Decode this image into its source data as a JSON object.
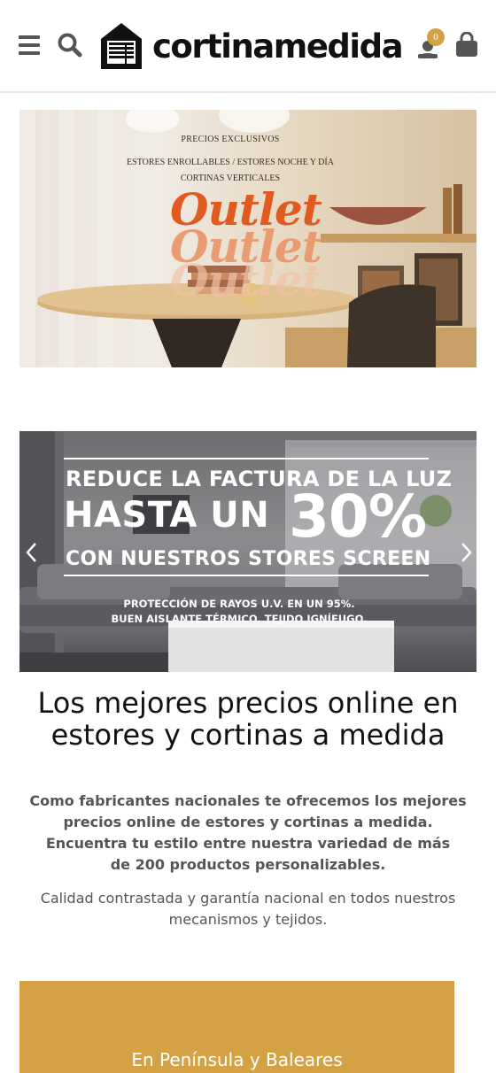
{
  "header": {
    "brand": "cortinamedida",
    "cart_count": "0"
  },
  "banner_outlet": {
    "line1": "PRECIOS EXCLUSIVOS",
    "line2": "ESTORES ENROLLABLES / ESTORES NOCHE Y DÍA",
    "line3": "CORTINAS VERTICALES",
    "word": "Outlet"
  },
  "banner_screen": {
    "line1": "REDUCE LA FACTURA DE LA LUZ",
    "line2": "HASTA UN",
    "percent": "30%",
    "line3": "CON NUESTROS STORES SCREEN",
    "note1": "PROTECCIÓN DE RAYOS U.V. EN UN 95%.",
    "note2": "BUEN AISLANTE TÉRMICO. TEJIDO IGNÍFUGO."
  },
  "content": {
    "headline": "Los mejores precios online en estores y cortinas a medida",
    "para1": "Como fabricantes nacionales te ofrecemos los mejores precios online de estores y cortinas a medida.",
    "para2": "Encuentra tu estilo entre nuestra variedad de más de 200 productos personalizables.",
    "para3": "Calidad contrastada y garantía nacional en todos nuestros mecanismos y tejidos."
  },
  "promo": {
    "label": "En Península y Baleares"
  },
  "icons": {
    "menu": "hamburger-menu-icon",
    "search": "search-icon",
    "user": "user-icon",
    "bag": "shopping-bag-icon",
    "prev": "chevron-left-icon",
    "next": "chevron-right-icon"
  },
  "colors": {
    "accent": "#d4a245",
    "outlet_orange": "#e15a1f"
  }
}
